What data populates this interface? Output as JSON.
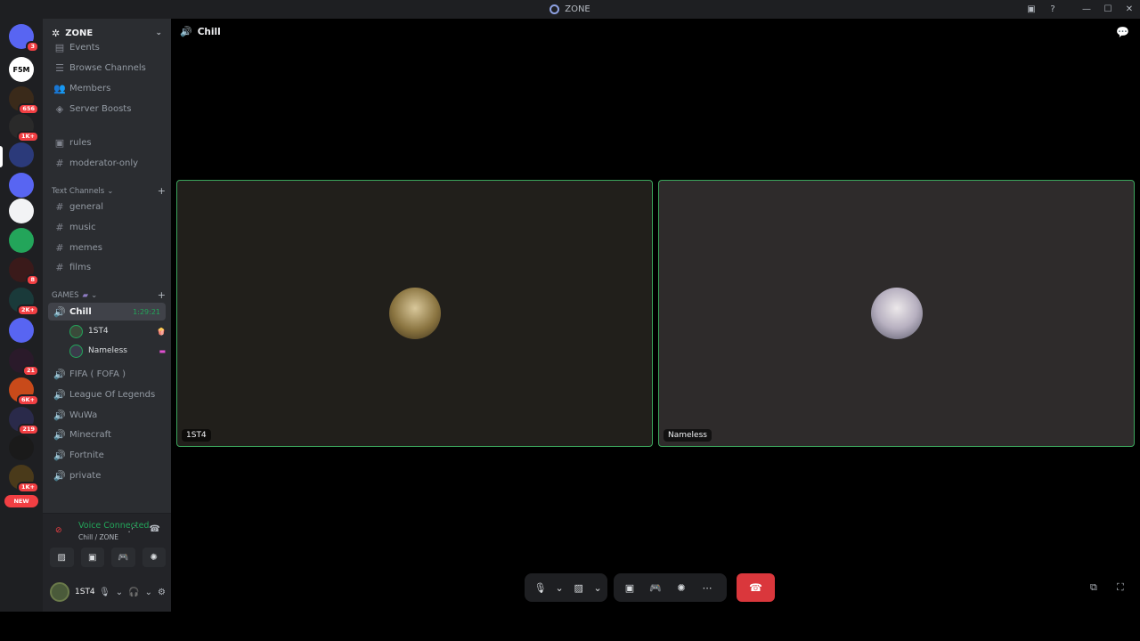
{
  "window": {
    "title": "ZONE",
    "controls": [
      "minimize-icon",
      "maximize-icon",
      "close-icon"
    ]
  },
  "guilds": {
    "items": [
      {
        "label": "",
        "color": "#5865f2",
        "badge": "3"
      },
      {
        "label": "F5M",
        "color": "#ffffff",
        "badge": ""
      },
      {
        "label": "",
        "color": "#3a2a1a",
        "badge": "656"
      },
      {
        "label": "",
        "color": "#2a2a2a",
        "badge": "1K+"
      },
      {
        "label": "",
        "color": "#2b3a7a",
        "badge": ""
      },
      {
        "label": "",
        "color": "#5865f2",
        "badge": ""
      },
      {
        "label": "",
        "color": "#f2f3f5",
        "badge": ""
      },
      {
        "label": "",
        "color": "#23a55a",
        "badge": ""
      },
      {
        "label": "",
        "color": "#3a1a1a",
        "badge": "8"
      },
      {
        "label": "",
        "color": "#1a3a3a",
        "badge": "2K+"
      },
      {
        "label": "",
        "color": "#5865f2",
        "badge": ""
      },
      {
        "label": "",
        "color": "#2a1a2a",
        "badge": "21"
      },
      {
        "label": "",
        "color": "#c84a1a",
        "badge": "6K+"
      },
      {
        "label": "",
        "color": "#2a2a4a",
        "badge": "219"
      },
      {
        "label": "",
        "color": "#1a1a1a",
        "badge": ""
      },
      {
        "label": "",
        "color": "#4a3a1a",
        "badge": "1K+"
      }
    ],
    "new_label": "NEW"
  },
  "server": {
    "name": "ZONE"
  },
  "sidebar": {
    "events": "Events",
    "browse": "Browse Channels",
    "members": "Members",
    "boosts": "Server Boosts",
    "rules": "rules",
    "modonly": "moderator-only",
    "text_category": "Text Channels",
    "text_channels": [
      "general",
      "music",
      "memes",
      "films"
    ],
    "games_category": "GAMES",
    "active_voice": "Chill",
    "active_timer": "1:29:21",
    "voice_users": [
      "1ST4",
      "Nameless"
    ],
    "voice_channels": [
      "FIFA ( FOFA )",
      "League Of Legends",
      "WuWa",
      "Minecraft",
      "Fortnite",
      "private"
    ]
  },
  "voice_panel": {
    "status": "Voice Connected",
    "location": "Chill / ZONE"
  },
  "user": {
    "name": "1ST4"
  },
  "main": {
    "channel": "Chill"
  },
  "tiles": [
    {
      "name": "1ST4"
    },
    {
      "name": "Nameless"
    }
  ],
  "colors": {
    "accent": "#3ba55c",
    "danger": "#da373c",
    "sidebar": "#2b2d31",
    "rail": "#1e1f22"
  }
}
